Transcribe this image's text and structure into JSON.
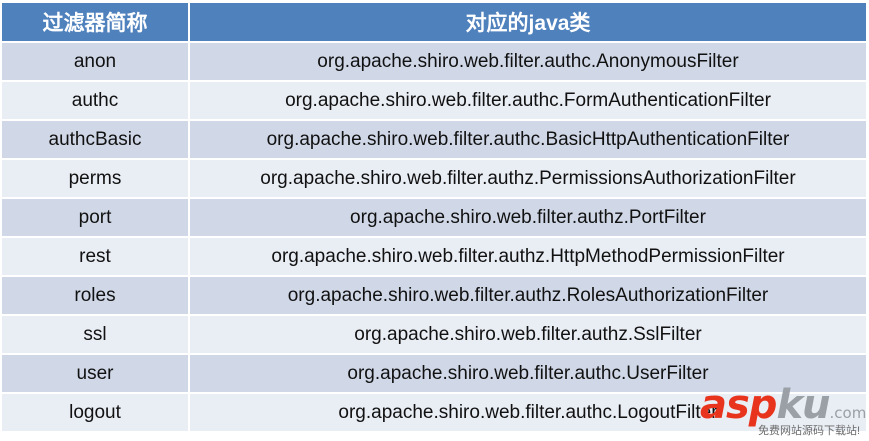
{
  "table": {
    "headers": [
      "过滤器简称",
      "对应的java类"
    ],
    "rows": [
      {
        "name": "anon",
        "class": "org.apache.shiro.web.filter.authc.AnonymousFilter"
      },
      {
        "name": "authc",
        "class": "org.apache.shiro.web.filter.authc.FormAuthenticationFilter"
      },
      {
        "name": "authcBasic",
        "class": "org.apache.shiro.web.filter.authc.BasicHttpAuthenticationFilter"
      },
      {
        "name": "perms",
        "class": "org.apache.shiro.web.filter.authz.PermissionsAuthorizationFilter"
      },
      {
        "name": "port",
        "class": "org.apache.shiro.web.filter.authz.PortFilter"
      },
      {
        "name": "rest",
        "class": "org.apache.shiro.web.filter.authz.HttpMethodPermissionFilter"
      },
      {
        "name": "roles",
        "class": "org.apache.shiro.web.filter.authz.RolesAuthorizationFilter"
      },
      {
        "name": "ssl",
        "class": "org.apache.shiro.web.filter.authz.SslFilter"
      },
      {
        "name": "user",
        "class": "org.apache.shiro.web.filter.authc.UserFilter"
      },
      {
        "name": "logout",
        "class": "org.apache.shiro.web.filter.authc.LogoutFilter"
      }
    ]
  },
  "colors": {
    "header_bg": "#4F81BD",
    "row_dark": "#D0D8E8",
    "row_light": "#E9EDF4",
    "header_text": "#FFFFFF"
  },
  "watermark": {
    "brand_a": "asp",
    "brand_b": "ku",
    "brand_c": ".com",
    "tagline": "免费网站源码下载站!"
  }
}
